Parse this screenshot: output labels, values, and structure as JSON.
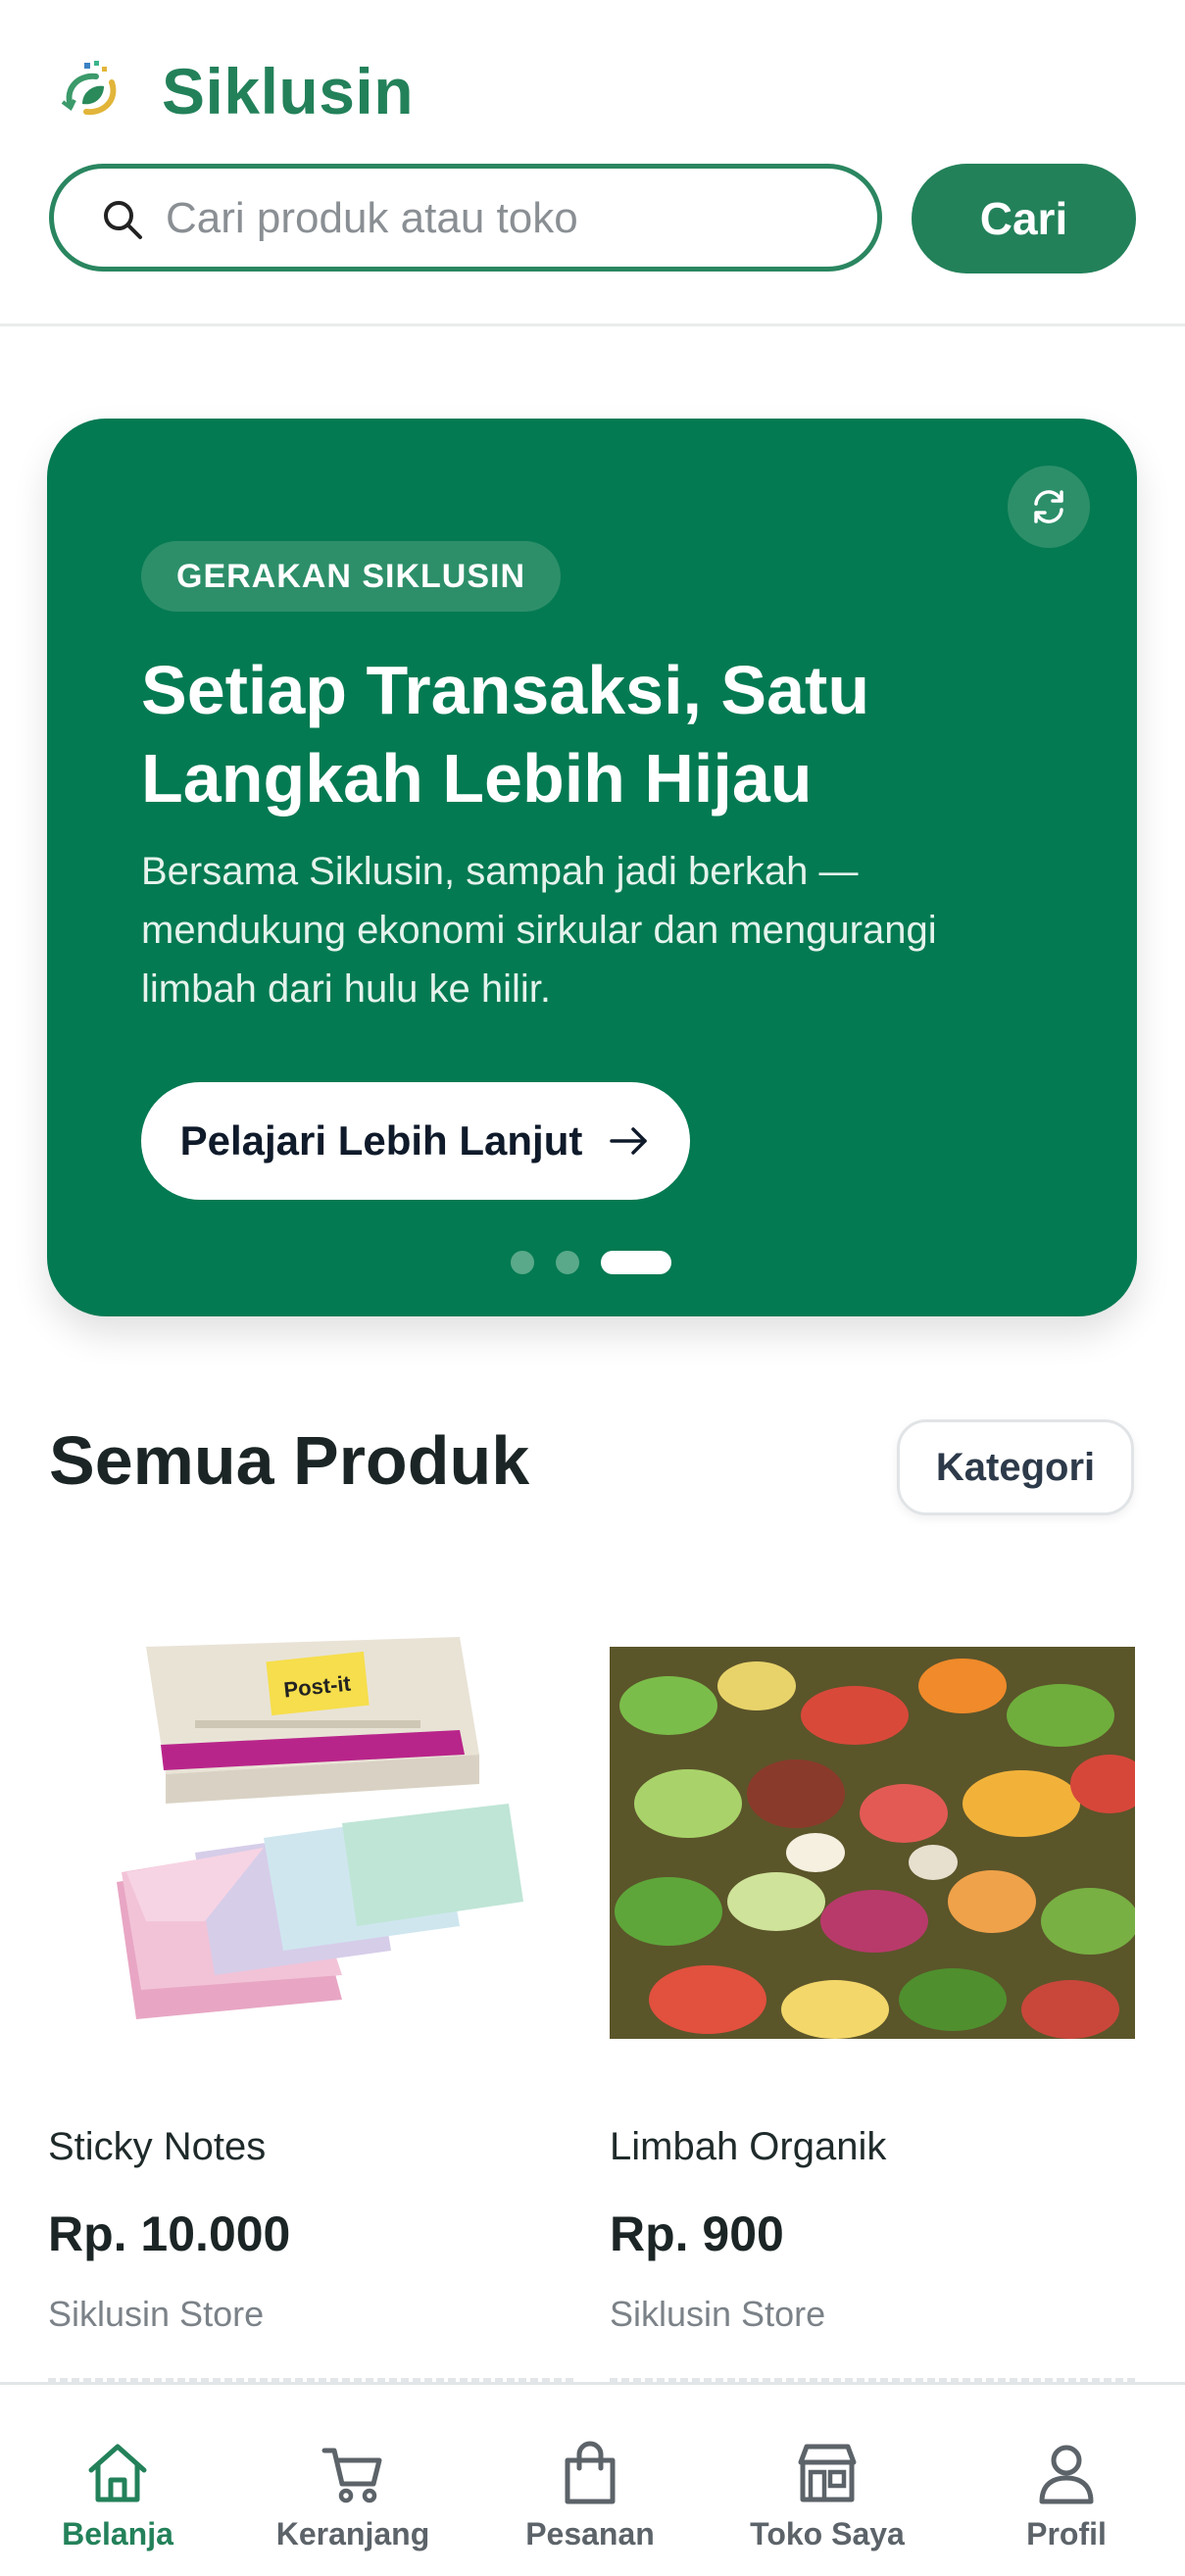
{
  "header": {
    "brand": "Siklusin",
    "search": {
      "placeholder": "Cari produk atau toko",
      "value": ""
    },
    "search_button": "Cari"
  },
  "banner": {
    "tag": "GERAKAN SIKLUSIN",
    "title": "Setiap Transaksi, Satu Langkah Lebih Hijau",
    "description": "Bersama Siklusin, sampah jadi berkah — mendukung ekonomi sirkular dan mengurangi limbah dari hulu ke hilir.",
    "cta": "Pelajari Lebih Lanjut",
    "slides": 3,
    "active_slide": 3
  },
  "products_section": {
    "title": "Semua Produk",
    "category_button": "Kategori",
    "products": [
      {
        "name": "Sticky Notes",
        "price": "Rp. 10.000",
        "store": "Siklusin Store"
      },
      {
        "name": "Limbah Organik",
        "price": "Rp. 900",
        "store": "Siklusin Store"
      }
    ]
  },
  "bottom_nav": {
    "items": [
      {
        "label": "Belanja",
        "icon": "home-icon",
        "active": true
      },
      {
        "label": "Keranjang",
        "icon": "cart-icon",
        "active": false
      },
      {
        "label": "Pesanan",
        "icon": "shopping-bag-icon",
        "active": false
      },
      {
        "label": "Toko Saya",
        "icon": "store-icon",
        "active": false
      },
      {
        "label": "Profil",
        "icon": "user-icon",
        "active": false
      }
    ]
  },
  "colors": {
    "brand": "#23815a",
    "banner_bg": "#047a52",
    "banner_chip": "#2d8f6a",
    "text_dark": "#1c2525",
    "text_muted": "#7b8288"
  }
}
